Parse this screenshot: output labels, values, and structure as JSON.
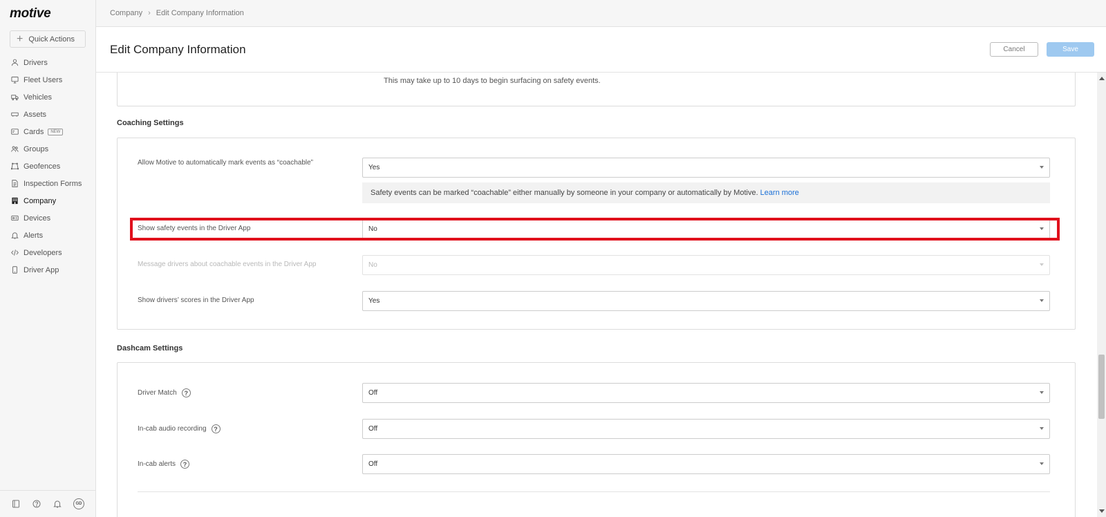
{
  "app": {
    "logo": "motive"
  },
  "sidebar": {
    "quick_actions": "Quick Actions",
    "items": [
      {
        "label": "Drivers",
        "icon": "person-icon"
      },
      {
        "label": "Fleet Users",
        "icon": "monitor-icon"
      },
      {
        "label": "Vehicles",
        "icon": "truck-icon"
      },
      {
        "label": "Assets",
        "icon": "trailer-icon"
      },
      {
        "label": "Cards",
        "icon": "card-icon",
        "badge": "NEW"
      },
      {
        "label": "Groups",
        "icon": "group-icon"
      },
      {
        "label": "Geofences",
        "icon": "geofence-icon"
      },
      {
        "label": "Inspection Forms",
        "icon": "document-icon"
      },
      {
        "label": "Company",
        "icon": "building-icon",
        "active": true
      },
      {
        "label": "Devices",
        "icon": "device-icon"
      },
      {
        "label": "Alerts",
        "icon": "bell-icon"
      },
      {
        "label": "Developers",
        "icon": "code-icon"
      },
      {
        "label": "Driver App",
        "icon": "phone-icon"
      }
    ],
    "bottom_icons": [
      "book-icon",
      "help-icon",
      "bell-icon",
      "avatar"
    ],
    "avatar_initials": "GD"
  },
  "breadcrumb": {
    "parent": "Company",
    "separator": "›",
    "current": "Edit Company Information"
  },
  "header": {
    "title": "Edit Company Information",
    "cancel_label": "Cancel",
    "save_label": "Save"
  },
  "top_card": {
    "note": "This may take up to 10 days to begin surfacing on safety events."
  },
  "coaching": {
    "title": "Coaching Settings",
    "rows": [
      {
        "label": "Allow Motive to automatically mark events as “coachable”",
        "value": "Yes"
      },
      {
        "label": "Show safety events in the Driver App",
        "value": "No"
      },
      {
        "label": "Message drivers about coachable events in the Driver App",
        "value": "No",
        "disabled": true
      },
      {
        "label": "Show drivers’ scores in the Driver App",
        "value": "Yes"
      }
    ],
    "info_text": "Safety events can be marked “coachable” either manually by someone in your company or automatically by Motive.",
    "info_link": "Learn more"
  },
  "dashcam": {
    "title": "Dashcam Settings",
    "rows": [
      {
        "label": "Driver Match",
        "value": "Off"
      },
      {
        "label": "In-cab audio recording",
        "value": "Off"
      },
      {
        "label": "In-cab alerts",
        "value": "Off"
      }
    ],
    "help_glyph": "?"
  },
  "colors": {
    "accent": "#1a6fd6",
    "save_button": "#9ec9f0",
    "highlight": "#e0101c"
  }
}
